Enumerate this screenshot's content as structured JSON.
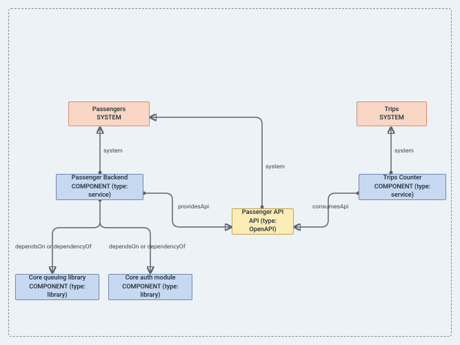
{
  "nodes": {
    "passengers": {
      "line1": "Passengers",
      "line2": "SYSTEM"
    },
    "trips": {
      "line1": "Trips",
      "line2": "SYSTEM"
    },
    "passengerBackend": {
      "line1": "Passenger Backend",
      "line2": "COMPONENT (type: service)"
    },
    "tripsCounter": {
      "line1": "Trips Counter",
      "line2": "COMPONENT (type: service)"
    },
    "passengerApi": {
      "line1": "Passenger API",
      "line2": "API (type: OpenAPI)"
    },
    "coreQueuing": {
      "line1": "Core queuing library",
      "line2": "COMPONENT (type: library)"
    },
    "coreAuth": {
      "line1": "Core auth module",
      "line2": "COMPONENT (type: library)"
    }
  },
  "labels": {
    "system1": "system",
    "system2": "system",
    "system3": "system",
    "providesApi": "providesApi",
    "consumesApi": "consumesApi",
    "deps1": "dependsOn or dependencyOf",
    "deps2": "dependsOn or dependencyOf"
  }
}
